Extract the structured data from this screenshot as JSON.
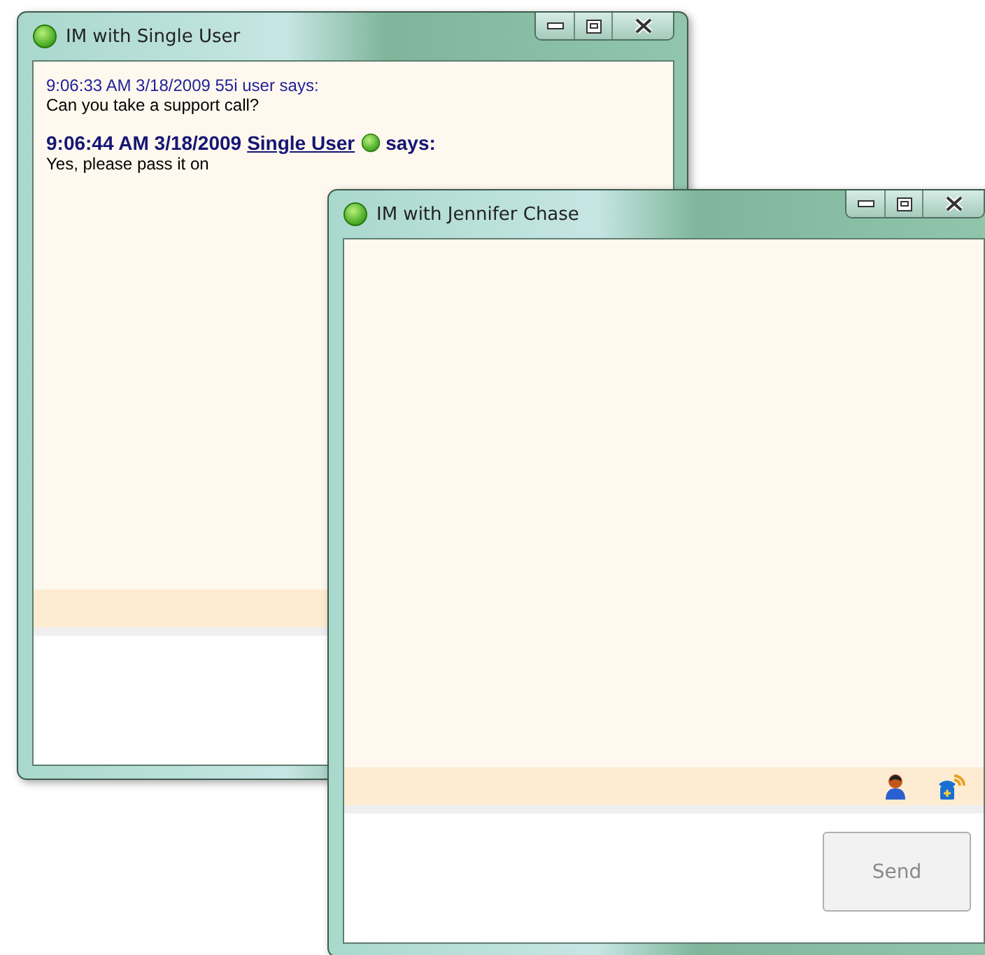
{
  "windows": [
    {
      "title": "IM with Single User",
      "messages": [
        {
          "kind": "plain",
          "header": "9:06:33 AM 3/18/2009 55i user says:",
          "body": "Can you take a support call?"
        },
        {
          "kind": "bold",
          "timestamp": "9:06:44 AM 3/18/2009",
          "sender": "Single User",
          "suffix": "says:",
          "body": "Yes, please pass it on"
        }
      ]
    },
    {
      "title": "IM with Jennifer Chase",
      "call_tools": true,
      "send_button": {
        "label": "Send",
        "disabled": true
      }
    }
  ]
}
